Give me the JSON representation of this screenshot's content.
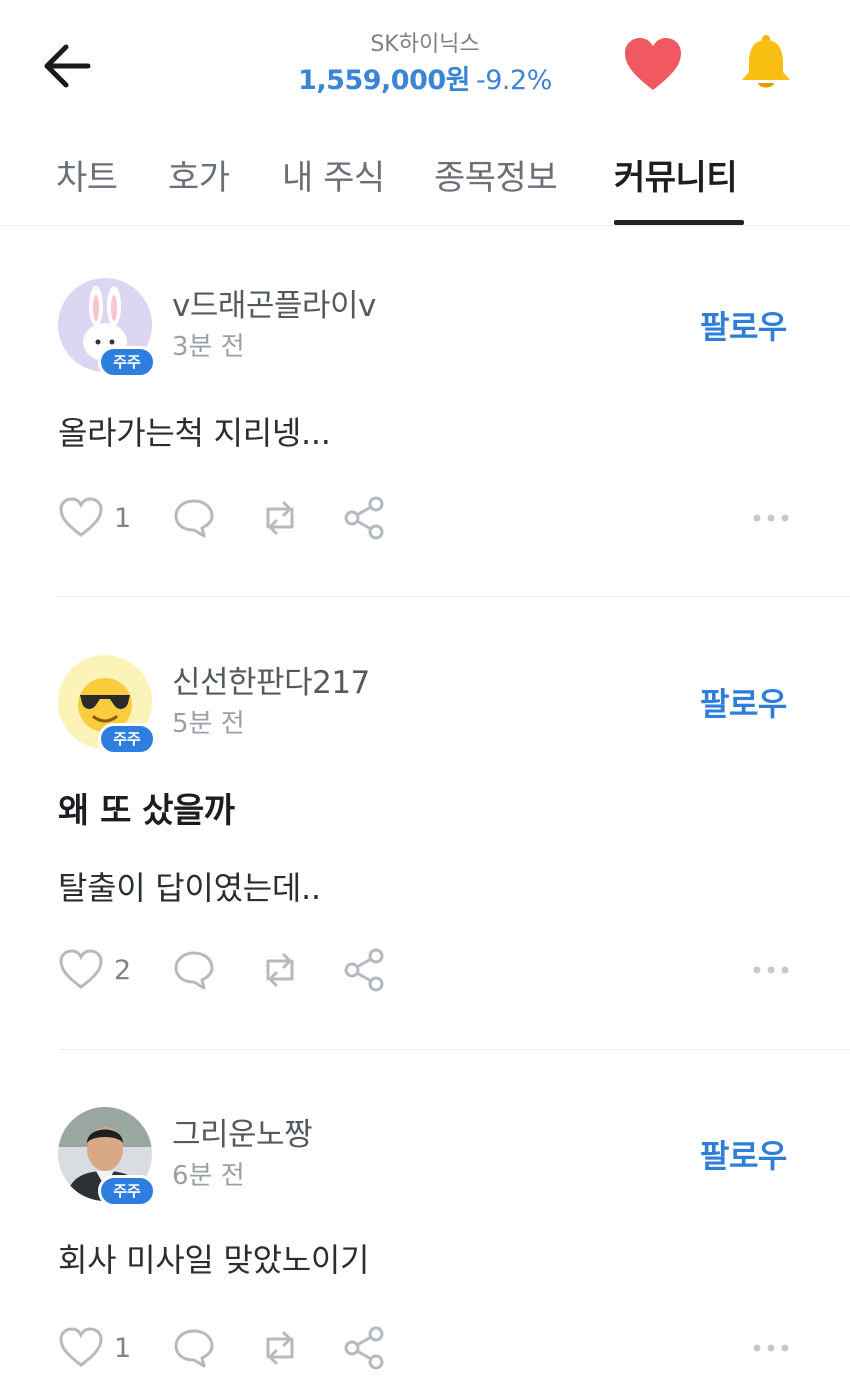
{
  "header": {
    "stock_name": "SK하이닉스",
    "price": "1,559,000원",
    "change": "-9.2%",
    "accent_color": "#3c84d6"
  },
  "tabs": [
    {
      "label": "차트"
    },
    {
      "label": "호가"
    },
    {
      "label": "내 주식"
    },
    {
      "label": "종목정보"
    },
    {
      "label": "커뮤니티",
      "active": true
    }
  ],
  "posts": [
    {
      "username": "v드래곤플라이v",
      "time": "3분 전",
      "badge": "주주",
      "follow_label": "팔로우",
      "title": "",
      "body": "올라가는척 지리넹...",
      "likes": "1",
      "avatar_icon": "rabbit-avatar-icon"
    },
    {
      "username": "신선한판다217",
      "time": "5분 전",
      "badge": "주주",
      "follow_label": "팔로우",
      "title": "왜 또 샀을까",
      "body": "탈출이 답이였는데..",
      "likes": "2",
      "avatar_icon": "sunglasses-face-avatar-icon"
    },
    {
      "username": "그리운노짱",
      "time": "6분 전",
      "badge": "주주",
      "follow_label": "팔로우",
      "title": "",
      "body": "회사 미사일 맞았노이기",
      "likes": "1",
      "avatar_icon": "person-photo-avatar-icon"
    }
  ]
}
